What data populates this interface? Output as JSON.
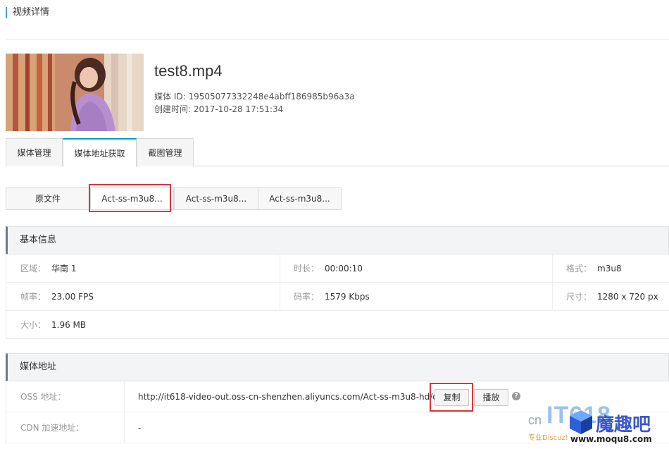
{
  "page": {
    "title": "视频详情"
  },
  "media": {
    "filename": "test8.mp4",
    "id_line": "媒体 ID: 19505077332248e4abff186985b96a3a",
    "created_line": "创建时间: 2017-10-28 17:51:34"
  },
  "tabs": [
    {
      "label": "媒体管理"
    },
    {
      "label": "媒体地址获取"
    },
    {
      "label": "截图管理"
    }
  ],
  "sub_tabs": [
    {
      "label": "原文件"
    },
    {
      "label": "Act-ss-m3u8..."
    },
    {
      "label": "Act-ss-m3u8..."
    },
    {
      "label": "Act-ss-m3u8..."
    }
  ],
  "basic_info": {
    "header": "基本信息",
    "region_label": "区域：",
    "region_value": "华南 1",
    "duration_label": "时长：",
    "duration_value": "00:00:10",
    "format_label": "格式：",
    "format_value": "m3u8",
    "fps_label": "帧率：",
    "fps_value": "23.00 FPS",
    "bitrate_label": "码率：",
    "bitrate_value": "1579 Kbps",
    "size_label": "尺寸：",
    "size_value": "1280 x 720 px",
    "filesize_label": "大小：",
    "filesize_value": "1.96 MB"
  },
  "media_address": {
    "header": "媒体地址",
    "oss_label": "OSS 地址：",
    "oss_url": "http://it618-video-out.oss-cn-shenzhen.aliyuncs.com/Act-ss-m3u8-hd/d29...",
    "cdn_label": "CDN 加速地址：",
    "cdn_value": "-",
    "copy_button": "复制",
    "play_button": "播放",
    "help": "?"
  },
  "watermark": {
    "cn": "cn",
    "it": "IT618",
    "brand": "魔趣吧",
    "sub": "专业Discuz!",
    "site": "www.moqu8.com"
  },
  "colors": {
    "accent": "#00a2ca",
    "highlight_box": "#d9363e",
    "section_bar": "#6b7b8c"
  }
}
